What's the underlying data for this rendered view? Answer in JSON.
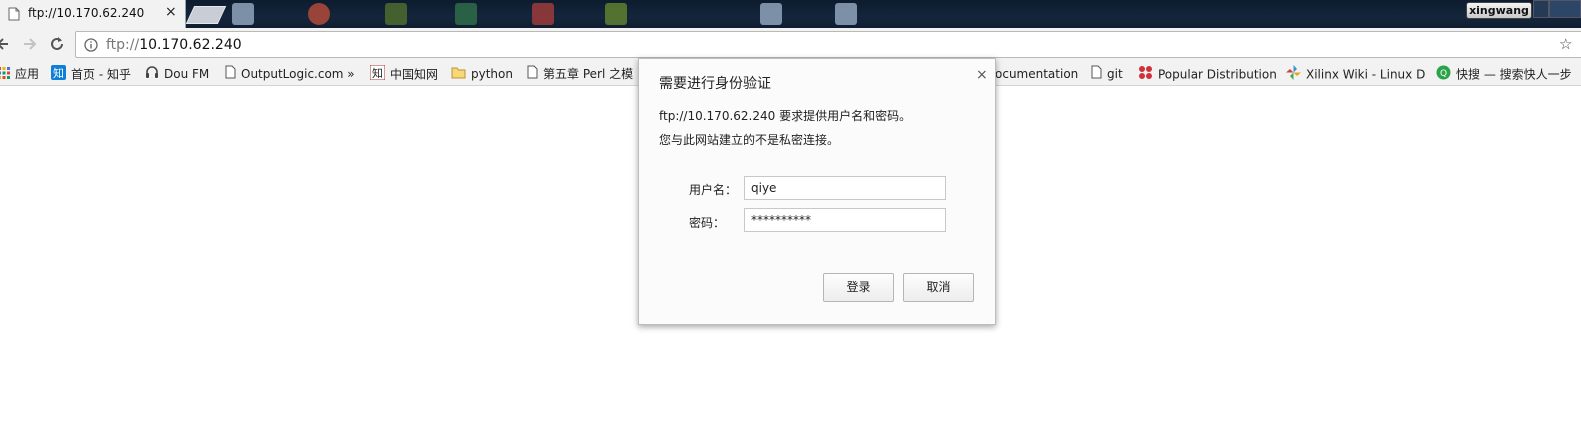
{
  "tab": {
    "title": "ftp://10.170.62.240",
    "close": "×"
  },
  "window": {
    "user_badge": "xingwang"
  },
  "toolbar": {
    "url_scheme": "ftp://",
    "url_host": "10.170.62.240"
  },
  "bookmarks": [
    {
      "label": "应用",
      "icon": "apps-grid-icon"
    },
    {
      "label": "首页 - 知乎",
      "icon": "zhihu-icon"
    },
    {
      "label": "Dou FM",
      "icon": "headphones-icon"
    },
    {
      "label": "OutputLogic.com »",
      "icon": "page-icon"
    },
    {
      "label": "中国知网",
      "icon": "cnki-icon"
    },
    {
      "label": "python",
      "icon": "folder-icon"
    },
    {
      "label": "第五章 Perl 之模",
      "icon": "page-icon"
    },
    {
      "label": "ocumentation",
      "icon": "none"
    },
    {
      "label": "git",
      "icon": "page-icon"
    },
    {
      "label": "Popular Distribution",
      "icon": "dots-icon"
    },
    {
      "label": "Xilinx Wiki - Linux D",
      "icon": "pinwheel-icon"
    },
    {
      "label": "快搜 — 搜索快人一步",
      "icon": "kuaisou-icon"
    }
  ],
  "dialog": {
    "title": "需要进行身份验证",
    "close": "×",
    "message_line1": "ftp://10.170.62.240 要求提供用户名和密码。",
    "message_line2": "您与此网站建立的不是私密连接。",
    "username_label": "用户名：",
    "username_value": "qiye",
    "password_label": "密码：",
    "password_value": "**********",
    "login_button": "登录",
    "cancel_button": "取消"
  }
}
